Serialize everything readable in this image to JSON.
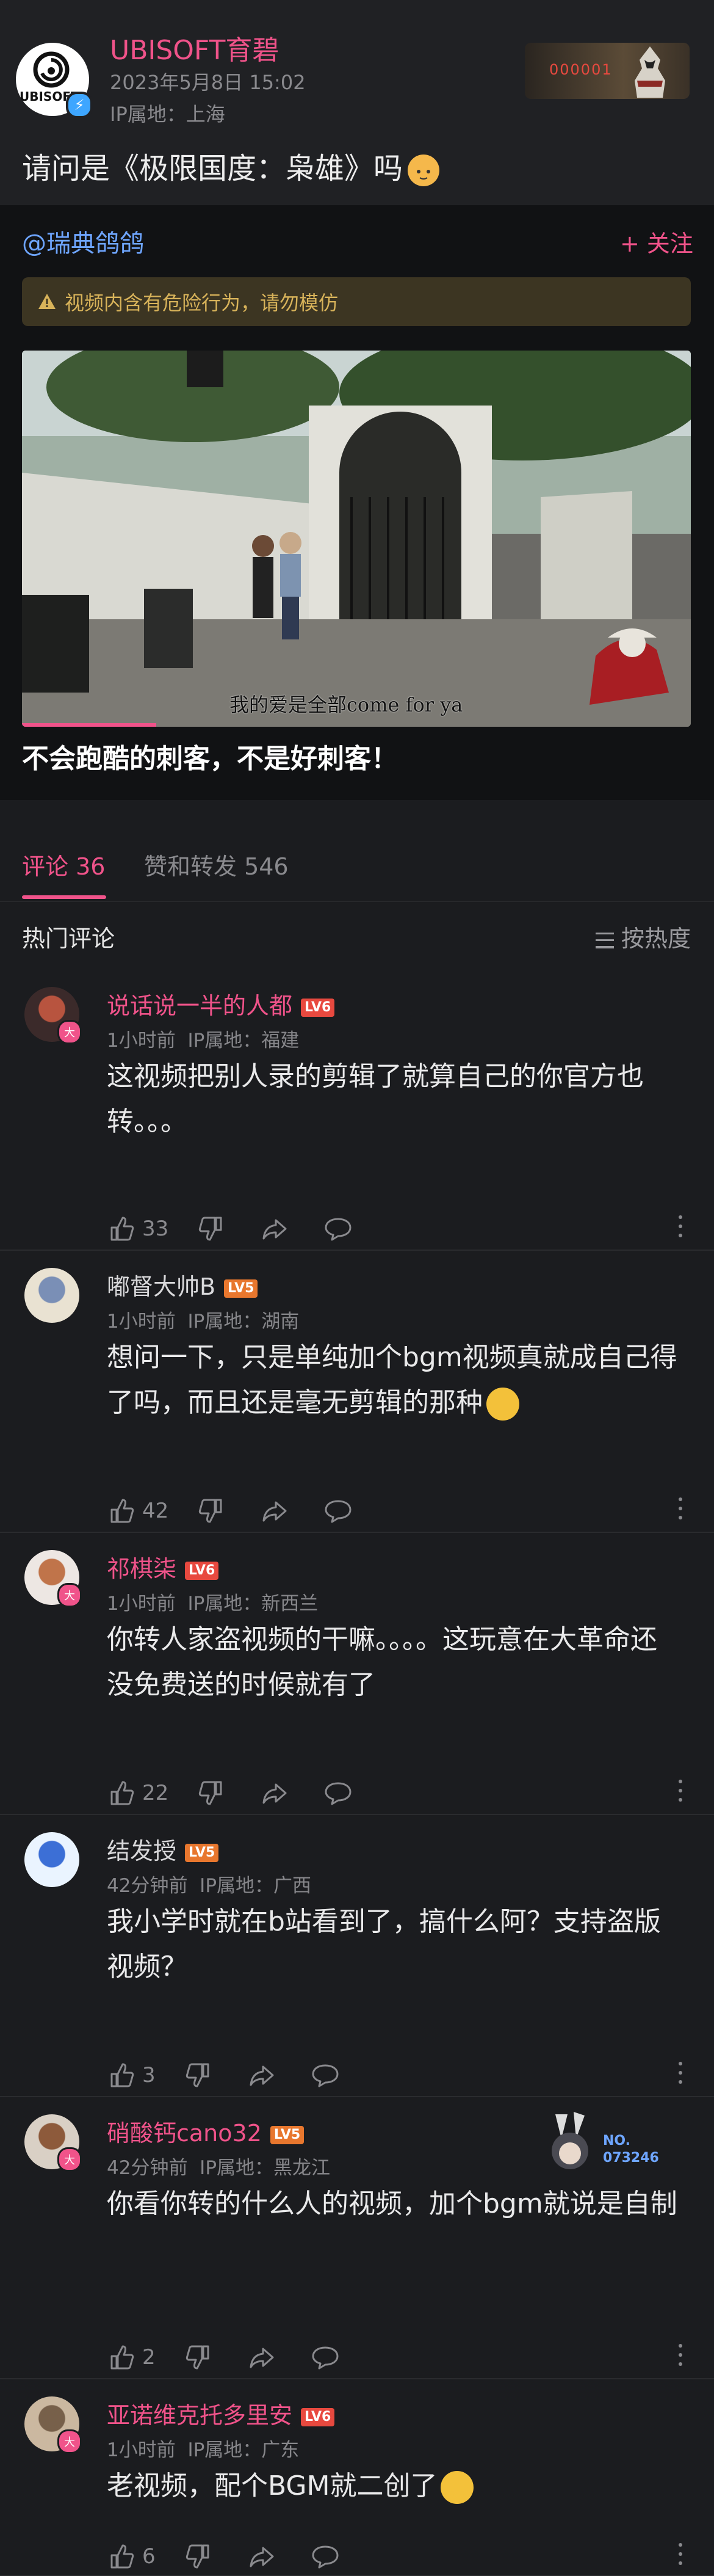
{
  "post": {
    "author": "UBISOFT育碧",
    "date": "2023年5月8日 15:02",
    "ip": "IP属地：上海",
    "avatar_logo": "UBISOFT",
    "badge_number": "000001",
    "text": "请问是《极限国度：枭雄》吗",
    "text_emoji": "cat-emoji"
  },
  "repost": {
    "user": "@瑞典鸽鸽",
    "follow_label": "+ 关注",
    "warning": "视频内含有危险行为，请勿模仿",
    "video_subtitle": "我的爱是全部come for ya",
    "caption": "不会跑酷的刺客，不是好刺客！"
  },
  "tabs": {
    "comments_label": "评论 36",
    "reposts_label": "赞和转发 546"
  },
  "hot": {
    "title": "热门评论",
    "sort_label": "按热度"
  },
  "colors": {
    "accent": "#f0538a",
    "link": "#6ea5ff",
    "lv5": "#e8772e",
    "lv6": "#e8493f"
  },
  "comments": [
    {
      "name": "说话说一半的人都",
      "name_color": "#f0538a",
      "level": "LV6",
      "level_color": "#e8493f",
      "time": "1小时前",
      "ip": "IP属地：福建",
      "text": "这视频把别人录的剪辑了就算自己的你官方也转。。。",
      "likes": "33",
      "avatar_tag": "大"
    },
    {
      "name": "嘟督大帅B",
      "name_color": "#d8d8da",
      "level": "LV5",
      "level_color": "#e8772e",
      "time": "1小时前",
      "ip": "IP属地：湖南",
      "text": "想问一下，只是单纯加个bgm视频真就成自己得了吗，而且还是毫无剪辑的那种",
      "likes": "42",
      "avatar_tag": ""
    },
    {
      "name": "祁棋柒",
      "name_color": "#f0538a",
      "level": "LV6",
      "level_color": "#e8493f",
      "time": "1小时前",
      "ip": "IP属地：新西兰",
      "text": "你转人家盗视频的干嘛。。。。这玩意在大革命还没免费送的时候就有了",
      "likes": "22",
      "avatar_tag": "大"
    },
    {
      "name": "结发授",
      "name_color": "#d8d8da",
      "level": "LV5",
      "level_color": "#e8772e",
      "time": "42分钟前",
      "ip": "IP属地：广西",
      "text": "我小学时就在b站看到了，搞什么阿？支持盗版视频？",
      "likes": "3",
      "avatar_tag": ""
    },
    {
      "name": "硝酸钙cano32",
      "name_color": "#f0538a",
      "level": "LV5",
      "level_color": "#e8772e",
      "time": "42分钟前",
      "ip": "IP属地：黑龙江",
      "text": "你看你转的什么人的视频，加个bgm就说是自制",
      "likes": "2",
      "avatar_tag": "大",
      "deco_text": "NO. 073246"
    },
    {
      "name": "亚诺维克托多里安",
      "name_color": "#f0538a",
      "level": "LV6",
      "level_color": "#e8493f",
      "time": "1小时前",
      "ip": "IP属地：广东",
      "text": "老视频，配个BGM就二创了",
      "likes": "6",
      "avatar_tag": "大"
    }
  ]
}
